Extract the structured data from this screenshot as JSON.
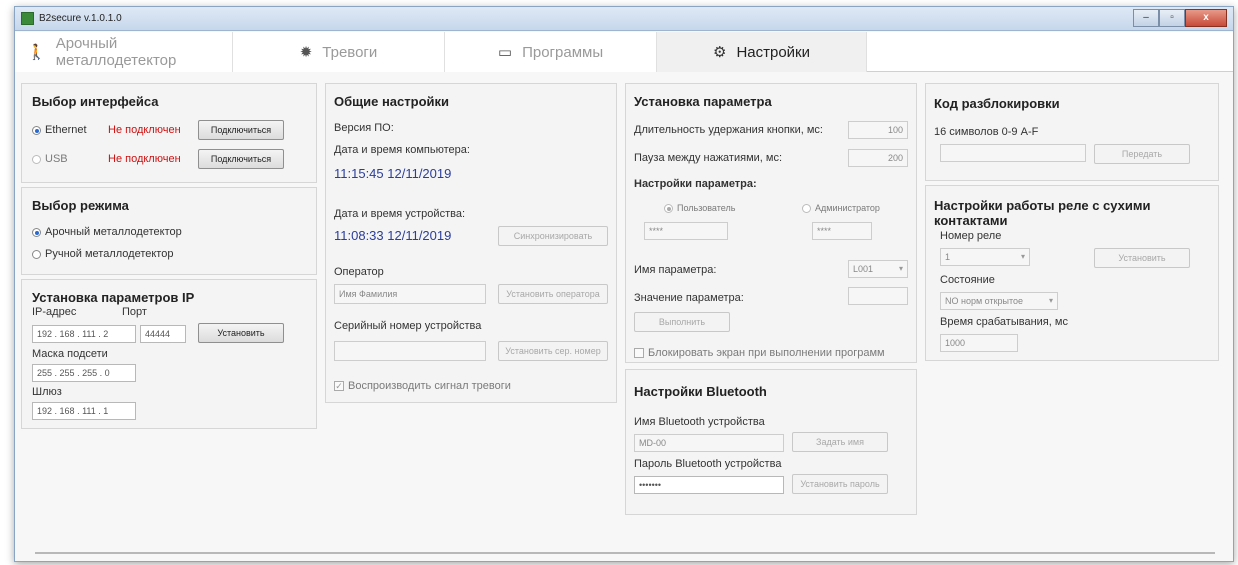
{
  "window": {
    "title": "B2secure v.1.0.1.0",
    "controls": {
      "minimize": "–",
      "maximize": "▫",
      "close": "x"
    }
  },
  "tabs": [
    {
      "label": "Арочный металлодетектор",
      "icon": "walk-through-detector-icon"
    },
    {
      "label": "Тревоги",
      "icon": "alarm-light-icon"
    },
    {
      "label": "Программы",
      "icon": "laptop-icon"
    },
    {
      "label": "Настройки",
      "icon": "gear-icon"
    }
  ],
  "interface": {
    "title": "Выбор интерфейса",
    "ethernet_label": "Ethernet",
    "ethernet_status": "Не подключен",
    "ethernet_button": "Подключиться",
    "usb_label": "USB",
    "usb_status": "Не подключен",
    "usb_button": "Подключиться",
    "status_color": "#d01010"
  },
  "mode": {
    "title": "Выбор режима",
    "option1": "Арочный металлодетектор",
    "option2": "Ручной металлодетектор"
  },
  "ip": {
    "title": "Установка параметров IP",
    "ip_label": "IP-адрес",
    "port_label": "Порт",
    "ip_octets": [
      "192",
      "168",
      "111",
      "2"
    ],
    "port": "44444",
    "set_button": "Установить",
    "mask_label": "Маска подсети",
    "mask_octets": [
      "255",
      "255",
      "255",
      "0"
    ],
    "gateway_label": "Шлюз",
    "gateway_octets": [
      "192",
      "168",
      "111",
      "1"
    ]
  },
  "general": {
    "title": "Общие настройки",
    "version_label": "Версия ПО:",
    "pc_time_label": "Дата и время компьютера:",
    "pc_time": "11:15:45 12/11/2019",
    "device_time_label": "Дата и время устройства:",
    "device_time": "11:08:33 12/11/2019",
    "sync_button": "Синхронизировать",
    "operator_label": "Оператор",
    "operator_value": "Имя Фамилия",
    "operator_button": "Установить оператора",
    "serial_label": "Серийный номер устройства",
    "serial_button": "Установить сер. номер",
    "alarm_sound_label": "Воспроизводить сигнал тревоги",
    "time_color": "#2a3d9a"
  },
  "param": {
    "title": "Установка параметра",
    "hold_label": "Длительность удержания кнопки, мс:",
    "hold_value": "100",
    "pause_label": "Пауза между нажатиями, мс:",
    "pause_value": "200",
    "settings_label": "Настройки параметра:",
    "user_label": "Пользователь",
    "admin_label": "Администратор",
    "user_pass": "****",
    "admin_pass": "****",
    "name_label": "Имя параметра:",
    "name_value": "L001",
    "value_label": "Значение параметра:",
    "run_button": "Выполнить",
    "lock_label": "Блокировать экран при выполнении программ"
  },
  "bluetooth": {
    "title": "Настройки Bluetooth",
    "name_label": "Имя Bluetooth устройства",
    "name_value": "MD-00",
    "name_button": "Задать имя",
    "pass_label": "Пароль Bluetooth устройства",
    "pass_value": "•••••••",
    "pass_button": "Установить пароль"
  },
  "unlock": {
    "title": "Код разблокировки",
    "hint": "16 символов 0-9 A-F",
    "send_button": "Передать"
  },
  "relay": {
    "title": "Настройки работы реле с сухими контактами",
    "number_label": "Номер реле",
    "number_value": "1",
    "set_button": "Установить",
    "state_label": "Состояние",
    "state_value": "NO норм открытое",
    "time_label": "Время срабатывания, мс",
    "time_value": "1000"
  }
}
